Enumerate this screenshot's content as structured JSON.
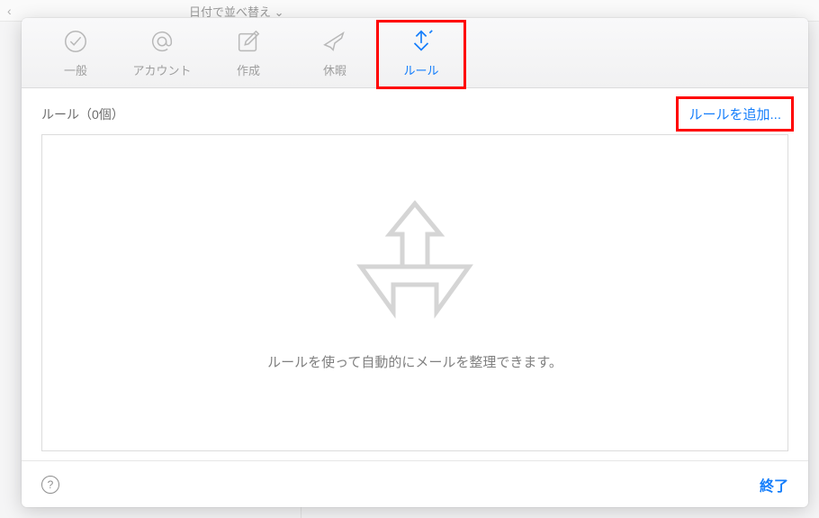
{
  "background": {
    "back_chevron": "‹",
    "sort_label": "日付で並べ替え ⌄"
  },
  "tabs": {
    "general": "一般",
    "accounts": "アカウント",
    "compose": "作成",
    "vacation": "休暇",
    "rules": "ルール"
  },
  "rules": {
    "count_label": "ルール（0個）",
    "add_label": "ルールを追加...",
    "empty_message": "ルールを使って自動的にメールを整理できます。"
  },
  "footer": {
    "help": "?",
    "done": "終了"
  }
}
